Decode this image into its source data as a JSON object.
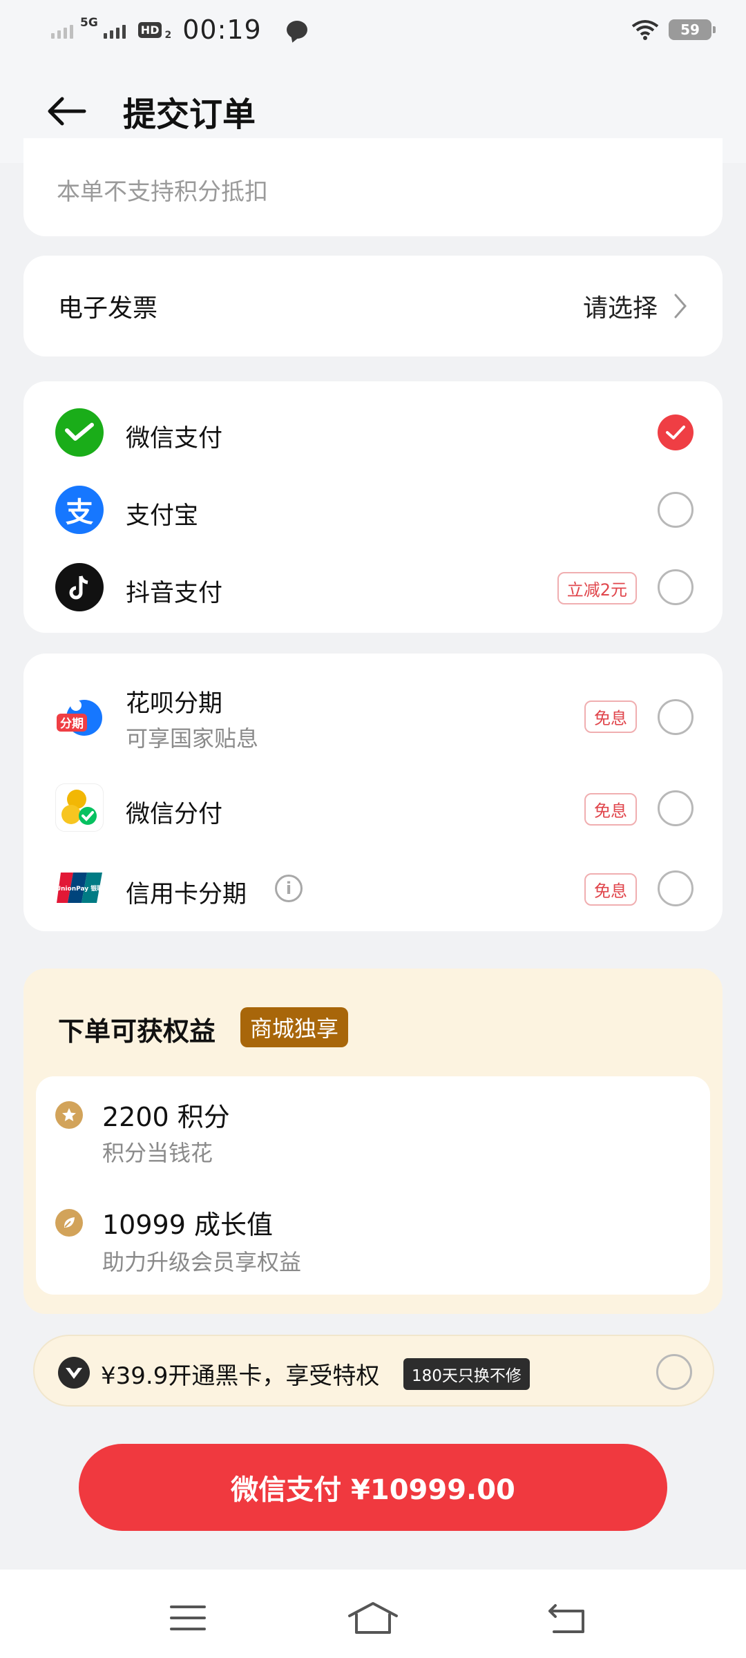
{
  "status_bar": {
    "network": "5G",
    "hd_label": "HD",
    "hd_sub": "2",
    "time": "00:19",
    "battery": "59"
  },
  "header": {
    "title": "提交订单"
  },
  "points_note": "本单不支持积分抵扣",
  "invoice": {
    "label": "电子发票",
    "value": "请选择"
  },
  "payment_methods": [
    {
      "label": "微信支付",
      "icon": "wechat-pay-icon",
      "selected": true
    },
    {
      "label": "支付宝",
      "icon": "alipay-icon",
      "selected": false
    },
    {
      "label": "抖音支付",
      "icon": "douyin-pay-icon",
      "tag": "立减2元",
      "selected": false
    }
  ],
  "installments": [
    {
      "label": "花呗分期",
      "sub": "可享国家贴息",
      "icon_text": "分期",
      "tag": "免息"
    },
    {
      "label": "微信分付",
      "tag": "免息"
    },
    {
      "label": "信用卡分期",
      "icon_text": "UnionPay 银联",
      "tag": "免息"
    }
  ],
  "benefits": {
    "title": "下单可获权益",
    "badge": "商城独享",
    "items": [
      {
        "main": "2200 积分",
        "sub": "积分当钱花"
      },
      {
        "main": "10999 成长值",
        "sub": "助力升级会员享权益"
      }
    ]
  },
  "vip": {
    "text": "¥39.9开通黑卡，享受特权",
    "tag": "180天只换不修"
  },
  "pay_button": {
    "label": "微信支付 ¥10999.00"
  },
  "colors": {
    "accent": "#f0393f",
    "benefit_bg": "#fcf3e0",
    "badge": "#a8660a"
  }
}
